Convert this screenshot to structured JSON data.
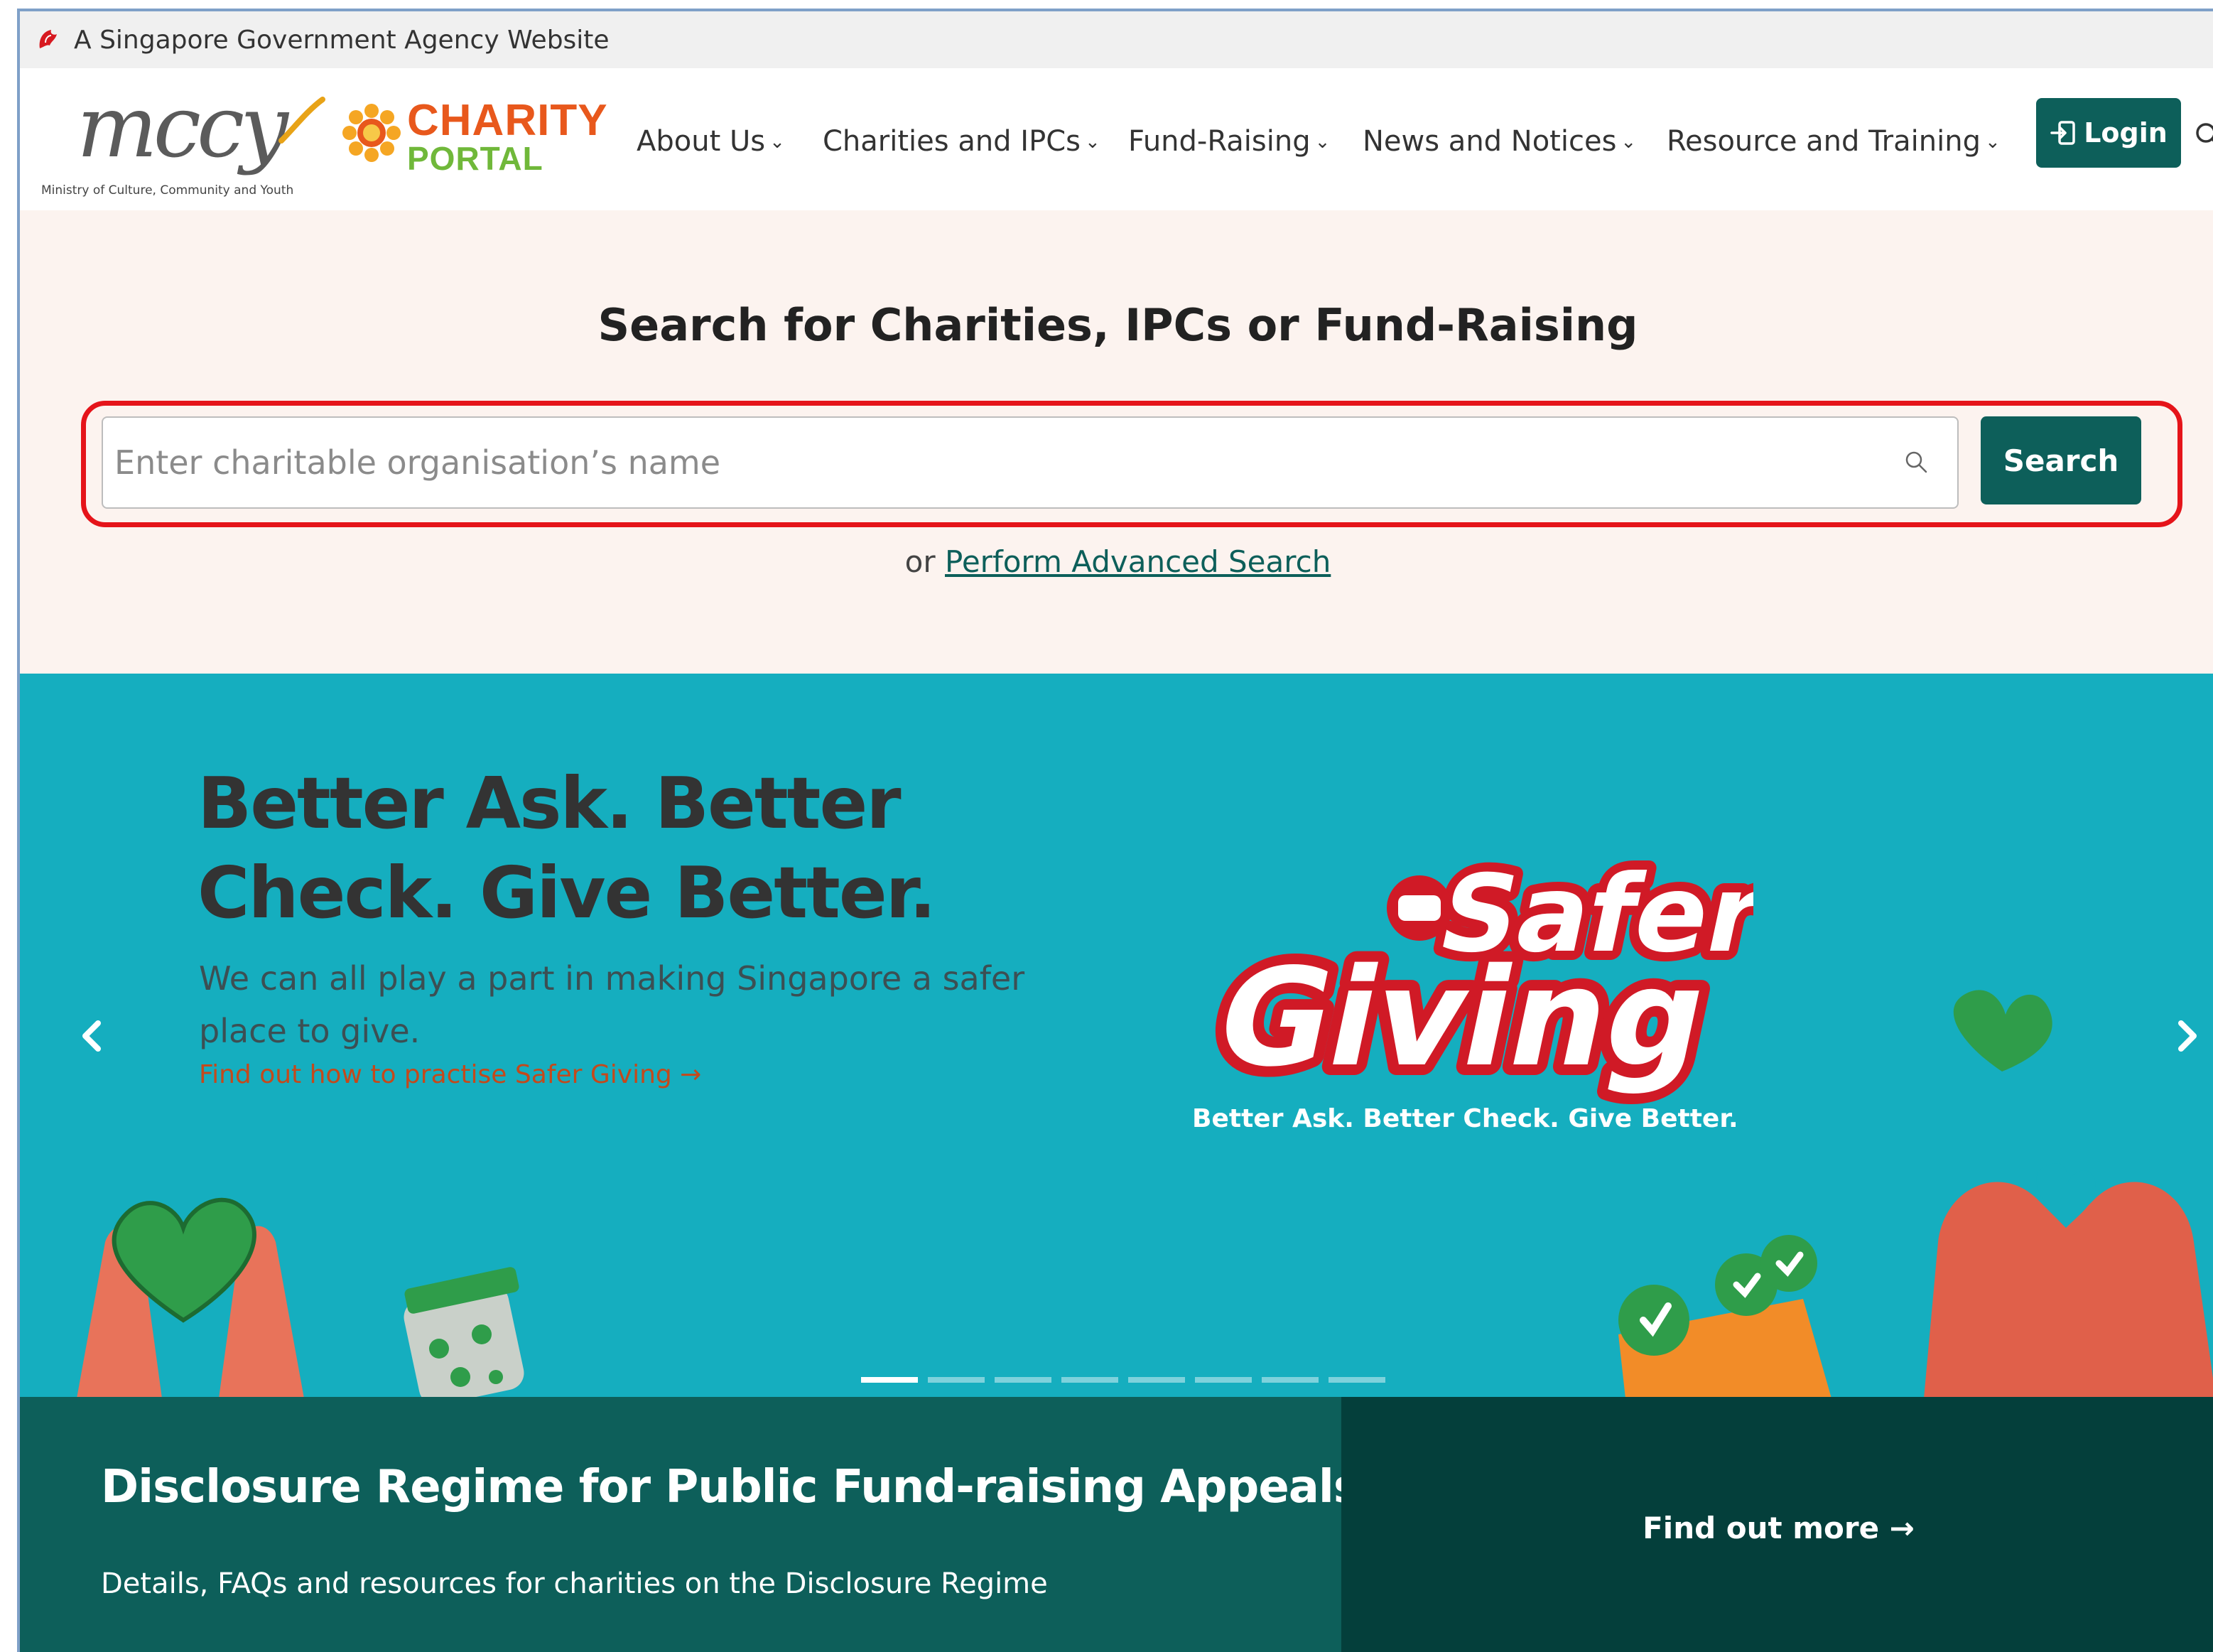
{
  "masthead": {
    "text": "A Singapore Government Agency Website",
    "icon": "lion-head-icon"
  },
  "logos": {
    "mccy_word": "mccy",
    "mccy_sub": "Ministry of Culture, Community and Youth",
    "charity_line1": "CHARITY",
    "charity_line2": "PORTAL"
  },
  "nav": {
    "items": [
      {
        "label": "About Us"
      },
      {
        "label": "Charities and IPCs"
      },
      {
        "label": "Fund-Raising"
      },
      {
        "label": "News and Notices"
      },
      {
        "label": "Resource and Training"
      }
    ],
    "login_label": "Login"
  },
  "search": {
    "title": "Search for Charities, IPCs or Fund-Raising",
    "placeholder": "Enter charitable organisation’s name",
    "value": "",
    "button_label": "Search",
    "or_text": "or",
    "advanced_link": "Perform Advanced Search"
  },
  "hero": {
    "headline": "Better Ask. Better Check. Give Better.",
    "body": "We can all play a part in making Singapore a safer place to give.",
    "link": "Find out how to practise Safer Giving →",
    "brand_top": "Safer",
    "brand_bottom": "Giving",
    "tagline": "Better Ask. Better Check. Give Better.",
    "slide_count": 8,
    "active_slide": 1
  },
  "disclosure": {
    "title": "Disclosure Regime for Public Fund-raising Appeals",
    "description": "Details, FAQs and resources for charities on the Disclosure Regime",
    "cta": "Find out more →"
  },
  "colors": {
    "brand_teal": "#0d5f5a",
    "brand_teal_dark": "#043f3b",
    "hero_bg": "#15aebf",
    "search_band_bg": "#fcf3ef",
    "highlight_red": "#e5141a",
    "link_orange": "#c4491b"
  }
}
